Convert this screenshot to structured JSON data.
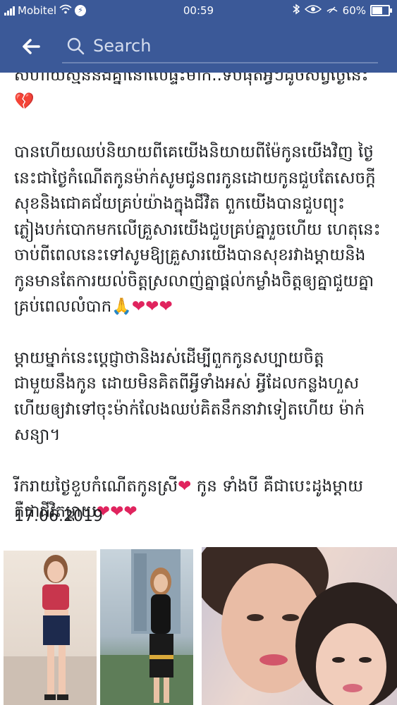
{
  "status_bar": {
    "carrier": "Mobitel",
    "time": "00:59",
    "battery": "60%",
    "battery_level": 0.6
  },
  "header": {
    "back_icon": "arrow-left-icon",
    "search_icon": "search-icon",
    "search_placeholder": "Search"
  },
  "post": {
    "paragraph_1": "សហាយស្មន់នឹងគ្នានៅលើផ្ទះម៉ាក់..ទីបំផុតអ្វីៗដូចសព្វថ្ងៃនេះ",
    "paragraph_2": "បានហើយឈប់និយាយពីគេយើងនិយាយពីម៉ែកូនយើងវិញ ថ្ងៃនេះជាថ្ងៃកំណើតកូនម៉ាក់សូមជូនពរកូនដោយកូនជួបតែសេចក្តីសុខនិងជោគជ័យគ្រប់យ៉ាងក្នុងជីវិត ពួកយើងបានជួបព្យុះភ្លៀងបក់បោកមកលើគ្រួសារយើងជួបគ្រប់គ្នារួចហើយ ហេតុនេះចាប់ពីពេលនេះទៅសូមឱ្យគ្រួសារយើងបានសុខរវាងម្តាយនិងកូនមានតែការយល់ចិត្តស្រលាញ់គ្នាផ្តល់កម្លាំងចិត្តឲ្យគ្នាជួយគ្នាគ្រប់ពេលលំបាក",
    "paragraph_3": "ម្តាយម្នាក់នេះប្តេជ្ញាថានិងរស់ដើម្បីពួកកូនសប្បាយចិត្តជាមួយនឹងកូន ដោយមិនគិតពីអ្វីទាំងអស់ អ្វីដែលកន្លងហួសហើយឲ្យវាទៅចុះម៉ាក់លែងឈប់គិតនឹកនាវាទៀតហើយ ម៉ាក់សន្យា។",
    "paragraph_4a": "រីករាយថ្ងៃខួបកំណើតកូនស្រី",
    "paragraph_4b": " កូន ទាំងបី គឺជាបេះដូងម្តាយគឺជាជីវិតម្តាយ",
    "emoji_broken_heart": "💔",
    "emoji_pray": "🙏",
    "emoji_heart": "❤",
    "date": "17.06.2019"
  },
  "photos": [
    {
      "name": "photo-girl-pink-top"
    },
    {
      "name": "photo-woman-black-dress"
    },
    {
      "name": "photo-selfie-two-women"
    }
  ]
}
